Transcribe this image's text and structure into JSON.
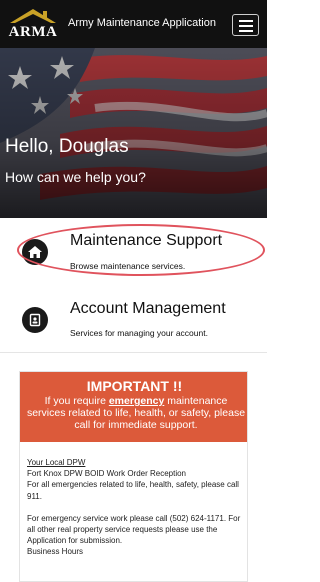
{
  "header": {
    "logo_text": "ARMA",
    "app_title": "Army Maintenance Application",
    "menu_icon": "hamburger-menu-icon"
  },
  "hero": {
    "greeting": "Hello, Douglas",
    "subtitle": "How can we help you?"
  },
  "menu": [
    {
      "icon": "home-icon",
      "title": "Maintenance Support",
      "subtitle": "Browse maintenance services."
    },
    {
      "icon": "account-badge-icon",
      "title": "Account Management",
      "subtitle": "Services for managing your account."
    }
  ],
  "important": {
    "title": "IMPORTANT !!",
    "message_before": "If you require ",
    "message_emphasis": "emergency",
    "message_after": " maintenance services related to life, health, or safety, please call for immediate support.",
    "local_link": "Your Local DPW",
    "lines": [
      "Fort Knox DPW BOID Work Order Reception",
      "For all emergencies related to life, health, safety,  please call 911."
    ],
    "paragraph": "For emergency service work please call  (502) 624-1171.  For all other real property service requests please use the Application for submission.",
    "hours_label": "Business Hours"
  },
  "colors": {
    "topbar": "#111111",
    "important_header": "#dc5a3a",
    "highlight_oval": "#e0535d"
  }
}
